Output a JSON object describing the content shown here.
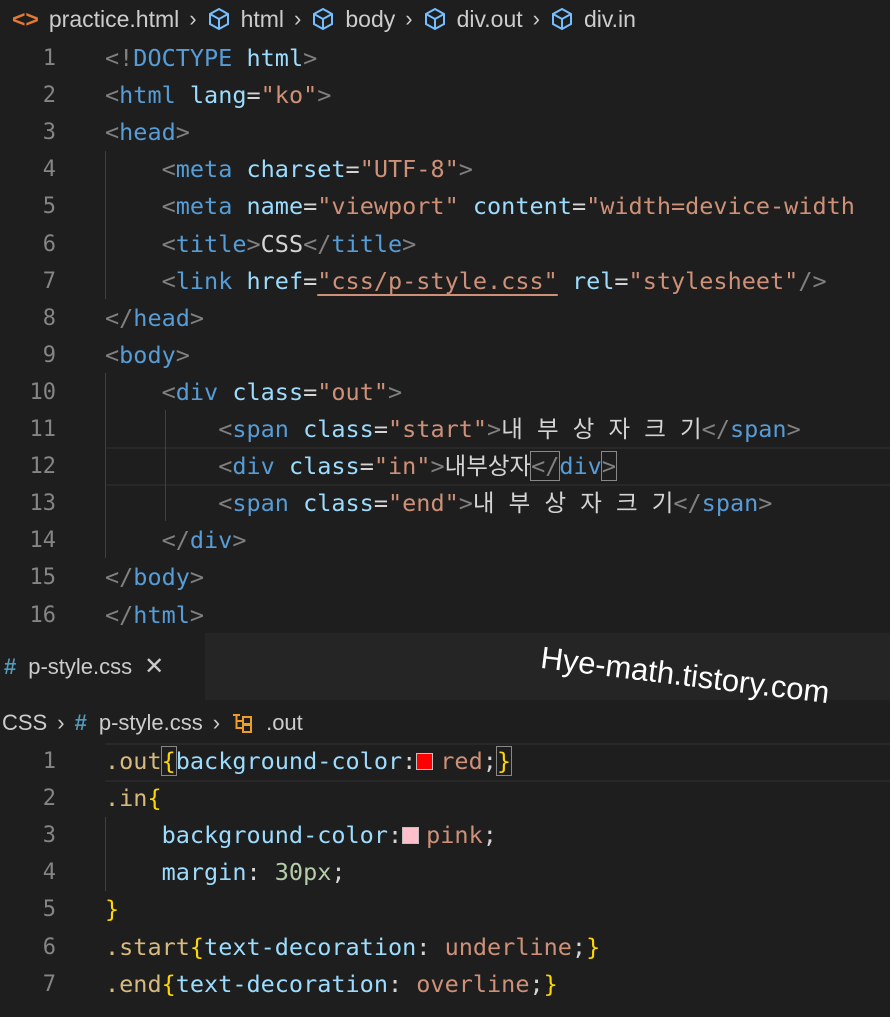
{
  "top_breadcrumb": {
    "items": [
      "practice.html",
      "html",
      "body",
      "div.out",
      "div.in"
    ]
  },
  "html_editor": {
    "line_numbers": [
      "1",
      "2",
      "3",
      "4",
      "5",
      "6",
      "7",
      "8",
      "9",
      "10",
      "11",
      "12",
      "13",
      "14",
      "15",
      "16"
    ],
    "lines": [
      [
        [
          "brk",
          "<!"
        ],
        [
          "tag",
          "DOCTYPE"
        ],
        [
          "txt",
          " "
        ],
        [
          "att",
          "html"
        ],
        [
          "brk",
          ">"
        ]
      ],
      [
        [
          "brk",
          "<"
        ],
        [
          "tag",
          "html"
        ],
        [
          "txt",
          " "
        ],
        [
          "att",
          "lang"
        ],
        [
          "txt",
          "="
        ],
        [
          "str",
          "\"ko\""
        ],
        [
          "brk",
          ">"
        ]
      ],
      [
        [
          "brk",
          "<"
        ],
        [
          "tag",
          "head"
        ],
        [
          "brk",
          ">"
        ]
      ],
      [
        [
          "txt",
          "    "
        ],
        [
          "brk",
          "<"
        ],
        [
          "tag",
          "meta"
        ],
        [
          "txt",
          " "
        ],
        [
          "att",
          "charset"
        ],
        [
          "txt",
          "="
        ],
        [
          "str",
          "\"UTF-8\""
        ],
        [
          "brk",
          ">"
        ]
      ],
      [
        [
          "txt",
          "    "
        ],
        [
          "brk",
          "<"
        ],
        [
          "tag",
          "meta"
        ],
        [
          "txt",
          " "
        ],
        [
          "att",
          "name"
        ],
        [
          "txt",
          "="
        ],
        [
          "str",
          "\"viewport\""
        ],
        [
          "txt",
          " "
        ],
        [
          "att",
          "content"
        ],
        [
          "txt",
          "="
        ],
        [
          "str",
          "\"width=device-width"
        ]
      ],
      [
        [
          "txt",
          "    "
        ],
        [
          "brk",
          "<"
        ],
        [
          "tag",
          "title"
        ],
        [
          "brk",
          ">"
        ],
        [
          "txt",
          "CSS"
        ],
        [
          "brk",
          "</"
        ],
        [
          "tag",
          "title"
        ],
        [
          "brk",
          ">"
        ]
      ],
      [
        [
          "txt",
          "    "
        ],
        [
          "brk",
          "<"
        ],
        [
          "tag",
          "link"
        ],
        [
          "txt",
          " "
        ],
        [
          "att",
          "href"
        ],
        [
          "txt",
          "="
        ],
        [
          "str",
          "\"css/p-style.css\""
        ],
        [
          "txt",
          " "
        ],
        [
          "att",
          "rel"
        ],
        [
          "txt",
          "="
        ],
        [
          "str",
          "\"stylesheet\""
        ],
        [
          "brk",
          "/>"
        ]
      ],
      [
        [
          "brk",
          "</"
        ],
        [
          "tag",
          "head"
        ],
        [
          "brk",
          ">"
        ]
      ],
      [
        [
          "brk",
          "<"
        ],
        [
          "tag",
          "body"
        ],
        [
          "brk",
          ">"
        ]
      ],
      [
        [
          "txt",
          "    "
        ],
        [
          "brk",
          "<"
        ],
        [
          "tag",
          "div"
        ],
        [
          "txt",
          " "
        ],
        [
          "att",
          "class"
        ],
        [
          "txt",
          "="
        ],
        [
          "str",
          "\"out\""
        ],
        [
          "brk",
          ">"
        ]
      ],
      [
        [
          "txt",
          "        "
        ],
        [
          "brk",
          "<"
        ],
        [
          "tag",
          "span"
        ],
        [
          "txt",
          " "
        ],
        [
          "att",
          "class"
        ],
        [
          "txt",
          "="
        ],
        [
          "str",
          "\"start\""
        ],
        [
          "brk",
          ">"
        ],
        [
          "txt",
          "내 부 상 자 크 기"
        ],
        [
          "brk",
          "</"
        ],
        [
          "tag",
          "span"
        ],
        [
          "brk",
          ">"
        ]
      ],
      [
        [
          "txt",
          "        "
        ],
        [
          "brk",
          "<"
        ],
        [
          "tag",
          "div"
        ],
        [
          "txt",
          " "
        ],
        [
          "att",
          "class"
        ],
        [
          "txt",
          "="
        ],
        [
          "str",
          "\"in\""
        ],
        [
          "brk",
          ">"
        ],
        [
          "txt",
          "내부상자"
        ],
        [
          "brk",
          "</"
        ],
        [
          "tag",
          "div"
        ],
        [
          "brk",
          ">"
        ]
      ],
      [
        [
          "txt",
          "        "
        ],
        [
          "brk",
          "<"
        ],
        [
          "tag",
          "span"
        ],
        [
          "txt",
          " "
        ],
        [
          "att",
          "class"
        ],
        [
          "txt",
          "="
        ],
        [
          "str",
          "\"end\""
        ],
        [
          "brk",
          ">"
        ],
        [
          "txt",
          "내 부 상 자 크 기"
        ],
        [
          "brk",
          "</"
        ],
        [
          "tag",
          "span"
        ],
        [
          "brk",
          ">"
        ]
      ],
      [
        [
          "txt",
          "    "
        ],
        [
          "brk",
          "</"
        ],
        [
          "tag",
          "div"
        ],
        [
          "brk",
          ">"
        ]
      ],
      [
        [
          "brk",
          "</"
        ],
        [
          "tag",
          "body"
        ],
        [
          "brk",
          ">"
        ]
      ],
      [
        [
          "brk",
          "</"
        ],
        [
          "tag",
          "html"
        ],
        [
          "brk",
          ">"
        ]
      ]
    ]
  },
  "css_tab": {
    "icon": "#",
    "label": "p-style.css",
    "close": "✕"
  },
  "css_breadcrumb": {
    "folder": "CSS",
    "file_icon": "#",
    "file": "p-style.css",
    "selector": ".out"
  },
  "css_editor": {
    "line_numbers": [
      "1",
      "2",
      "3",
      "4",
      "5",
      "6",
      "7"
    ],
    "lines": [
      [
        [
          "sel",
          ".out"
        ],
        [
          "cb",
          "{"
        ],
        [
          "prop",
          "background-color"
        ],
        [
          "pun",
          ":"
        ],
        [
          "swatch",
          "#ff0000"
        ],
        [
          "val",
          "red"
        ],
        [
          "pun",
          ";"
        ],
        [
          "cb",
          "}"
        ]
      ],
      [
        [
          "sel",
          ".in"
        ],
        [
          "cb",
          "{"
        ]
      ],
      [
        [
          "txt",
          "    "
        ],
        [
          "prop",
          "background-color"
        ],
        [
          "pun",
          ":"
        ],
        [
          "swatch",
          "#ffc0cb"
        ],
        [
          "val",
          "pink"
        ],
        [
          "pun",
          ";"
        ]
      ],
      [
        [
          "txt",
          "    "
        ],
        [
          "prop",
          "margin"
        ],
        [
          "pun",
          ": "
        ],
        [
          "num",
          "30px"
        ],
        [
          "pun",
          ";"
        ]
      ],
      [
        [
          "cb",
          "}"
        ]
      ],
      [
        [
          "sel",
          ".start"
        ],
        [
          "cb",
          "{"
        ],
        [
          "prop",
          "text-decoration"
        ],
        [
          "pun",
          ": "
        ],
        [
          "val",
          "underline"
        ],
        [
          "pun",
          ";"
        ],
        [
          "cb",
          "}"
        ]
      ],
      [
        [
          "sel",
          ".end"
        ],
        [
          "cb",
          "{"
        ],
        [
          "prop",
          "text-decoration"
        ],
        [
          "pun",
          ": "
        ],
        [
          "val",
          "overline"
        ],
        [
          "pun",
          ";"
        ],
        [
          "cb",
          "}"
        ]
      ]
    ]
  },
  "watermark": "Hye-math.tistory.com"
}
